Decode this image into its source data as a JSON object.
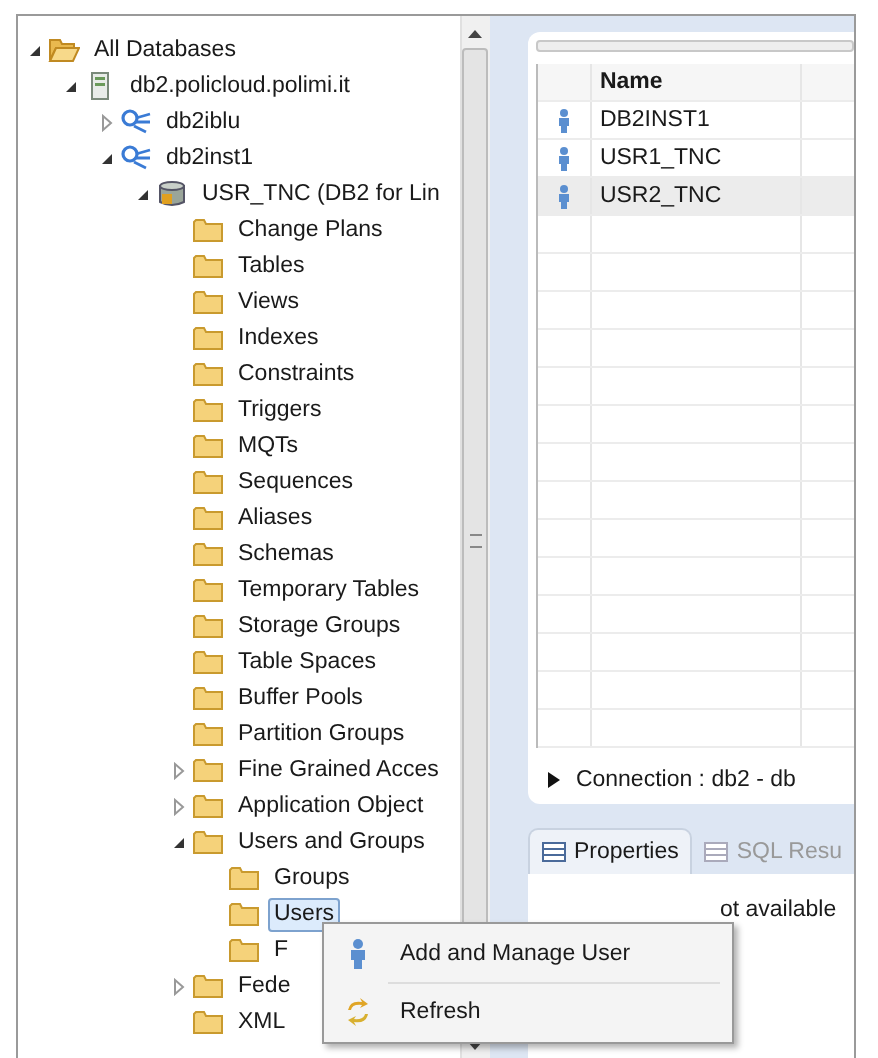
{
  "tree": [
    {
      "label": "All Databases",
      "kind": "folder-open",
      "expanded": true,
      "selected": false,
      "children": [
        {
          "label": "db2.policloud.polimi.it",
          "kind": "server",
          "expanded": true,
          "selected": false,
          "children": [
            {
              "label": "db2iblu",
              "kind": "instance",
              "expanded": false,
              "selected": false
            },
            {
              "label": "db2inst1",
              "kind": "instance",
              "expanded": true,
              "selected": false,
              "children": [
                {
                  "label": "USR_TNC (DB2 for Lin",
                  "kind": "database",
                  "expanded": true,
                  "selected": false,
                  "children": [
                    {
                      "label": "Change Plans",
                      "kind": "folder",
                      "selected": false
                    },
                    {
                      "label": "Tables",
                      "kind": "folder",
                      "selected": false
                    },
                    {
                      "label": "Views",
                      "kind": "folder",
                      "selected": false
                    },
                    {
                      "label": "Indexes",
                      "kind": "folder",
                      "selected": false
                    },
                    {
                      "label": "Constraints",
                      "kind": "folder",
                      "selected": false
                    },
                    {
                      "label": "Triggers",
                      "kind": "folder",
                      "selected": false
                    },
                    {
                      "label": "MQTs",
                      "kind": "folder",
                      "selected": false
                    },
                    {
                      "label": "Sequences",
                      "kind": "folder",
                      "selected": false
                    },
                    {
                      "label": "Aliases",
                      "kind": "folder",
                      "selected": false
                    },
                    {
                      "label": "Schemas",
                      "kind": "folder",
                      "selected": false
                    },
                    {
                      "label": "Temporary Tables",
                      "kind": "folder",
                      "selected": false
                    },
                    {
                      "label": "Storage Groups",
                      "kind": "folder",
                      "selected": false
                    },
                    {
                      "label": "Table Spaces",
                      "kind": "folder",
                      "selected": false
                    },
                    {
                      "label": "Buffer Pools",
                      "kind": "folder",
                      "selected": false
                    },
                    {
                      "label": "Partition Groups",
                      "kind": "folder",
                      "selected": false
                    },
                    {
                      "label": "Fine Grained Acces",
                      "kind": "folder",
                      "expanded": false,
                      "selected": false
                    },
                    {
                      "label": "Application Object",
                      "kind": "folder",
                      "expanded": false,
                      "selected": false
                    },
                    {
                      "label": "Users and Groups",
                      "kind": "folder",
                      "expanded": true,
                      "selected": false,
                      "children": [
                        {
                          "label": "Groups",
                          "kind": "folder",
                          "selected": false
                        },
                        {
                          "label": "Users",
                          "kind": "folder",
                          "selected": true
                        },
                        {
                          "label": "F",
                          "kind": "folder",
                          "selected": false
                        }
                      ]
                    },
                    {
                      "label": "Fede",
                      "kind": "folder",
                      "expanded": false,
                      "selected": false
                    },
                    {
                      "label": "XML",
                      "kind": "folder",
                      "selected": false
                    }
                  ]
                }
              ]
            }
          ]
        }
      ]
    }
  ],
  "users_table": {
    "columns": [
      "Name"
    ],
    "rows": [
      {
        "name": "DB2INST1",
        "selected": false
      },
      {
        "name": "USR1_TNC",
        "selected": false
      },
      {
        "name": "USR2_TNC",
        "selected": true
      }
    ]
  },
  "connection": {
    "label": "Connection : db2 - db",
    "expanded": false
  },
  "tabs": [
    {
      "label": "Properties",
      "selected": true
    },
    {
      "label": "SQL Resu",
      "selected": false
    }
  ],
  "properties_message": "ot available",
  "context_menu": {
    "items": [
      {
        "label": "Add and Manage User",
        "kind": "user"
      },
      {
        "label": "Refresh",
        "kind": "refresh"
      }
    ]
  }
}
